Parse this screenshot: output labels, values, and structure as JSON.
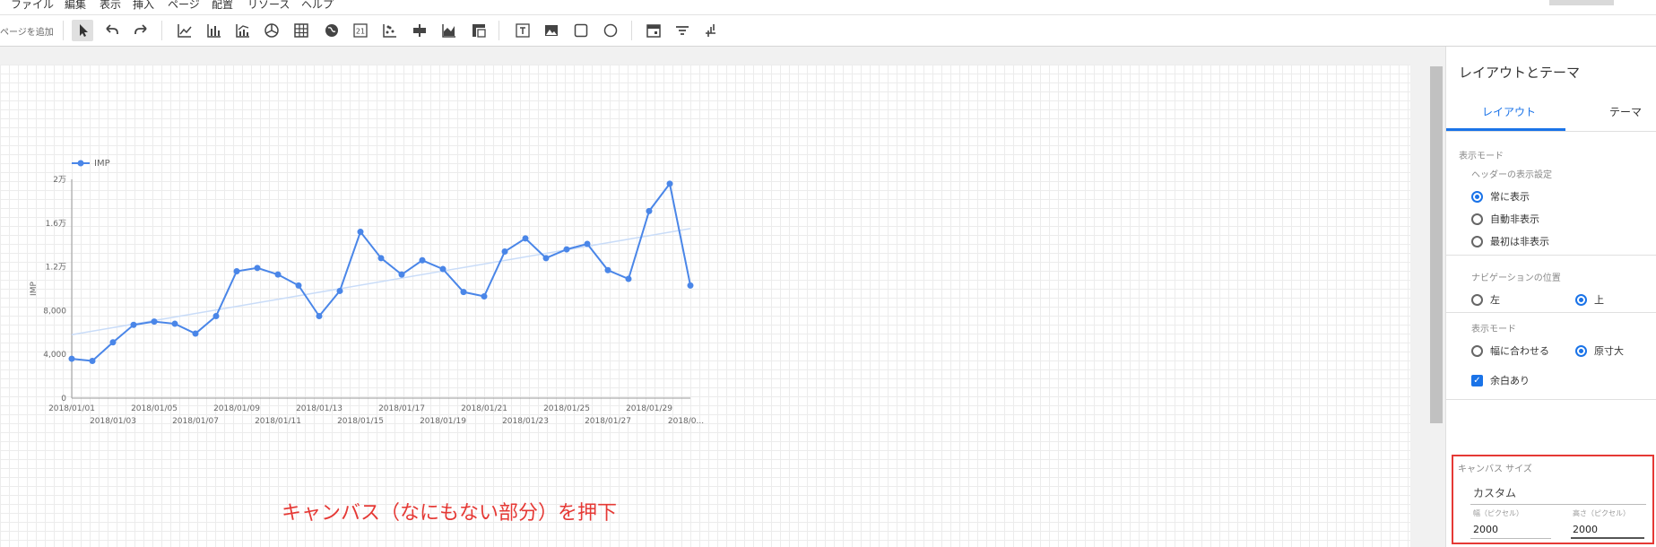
{
  "menu": {
    "items": [
      "ファイル",
      "編集",
      "表示",
      "挿入",
      "ページ",
      "配置",
      "リソース",
      "ヘルプ"
    ]
  },
  "toolbar": {
    "add_page": "ページを追加",
    "tools": [
      "select-cursor-icon",
      "undo-icon",
      "redo-icon",
      "line-chart-icon",
      "bar-chart-icon",
      "combo-chart-icon",
      "pie-chart-icon",
      "table-icon",
      "geo-map-icon",
      "scorecard-icon",
      "scatter-chart-icon",
      "bullet-chart-icon",
      "area-chart-icon",
      "pivot-table-icon",
      "text-box-icon",
      "image-icon",
      "rectangle-icon",
      "circle-icon",
      "date-range-icon",
      "filter-icon",
      "data-control-icon"
    ],
    "scorecard_text": "21"
  },
  "chart_data": {
    "type": "line",
    "legend": "IMP",
    "legend_position": "top-left",
    "ylabel": "IMP",
    "yticks": [
      "0",
      "4,000",
      "8,000",
      "1.2万",
      "1.6万",
      "2万"
    ],
    "ylim": [
      0,
      20000
    ],
    "x_tick_labels_upper": [
      "2018/01/01",
      "2018/01/05",
      "2018/01/09",
      "2018/01/13",
      "2018/01/17",
      "2018/01/21",
      "2018/01/25",
      "2018/01/29"
    ],
    "x_tick_labels_lower": [
      "2018/01/03",
      "2018/01/07",
      "2018/01/11",
      "2018/01/15",
      "2018/01/19",
      "2018/01/23",
      "2018/01/27",
      "2018/0..."
    ],
    "x": [
      "2018/01/01",
      "2018/01/02",
      "2018/01/03",
      "2018/01/04",
      "2018/01/05",
      "2018/01/06",
      "2018/01/07",
      "2018/01/08",
      "2018/01/09",
      "2018/01/10",
      "2018/01/11",
      "2018/01/12",
      "2018/01/13",
      "2018/01/14",
      "2018/01/15",
      "2018/01/16",
      "2018/01/17",
      "2018/01/18",
      "2018/01/19",
      "2018/01/20",
      "2018/01/21",
      "2018/01/22",
      "2018/01/23",
      "2018/01/24",
      "2018/01/25",
      "2018/01/26",
      "2018/01/27",
      "2018/01/28",
      "2018/01/29",
      "2018/01/30",
      "2018/01/31"
    ],
    "values": [
      3600,
      3400,
      5100,
      6700,
      7000,
      6800,
      5900,
      7500,
      11600,
      11900,
      11300,
      10300,
      7500,
      9800,
      15200,
      12800,
      11300,
      12600,
      11800,
      9700,
      9300,
      13400,
      14600,
      12800,
      13600,
      14100,
      11700,
      10900,
      17100,
      19600,
      10300
    ],
    "trendline": {
      "start": 5800,
      "end": 15500
    },
    "colors": {
      "series": "#4a86e8",
      "trend": "#c9dcf8",
      "axis": "#999999"
    },
    "grid": false
  },
  "annotation": "キャンバス（なにもない部分）を押下",
  "panel": {
    "title": "レイアウトとテーマ",
    "tabs": [
      "レイアウト",
      "テーマ"
    ],
    "display_mode_label": "表示モード",
    "header_label": "ヘッダーの表示設定",
    "header_options": [
      "常に表示",
      "自動非表示",
      "最初は非表示"
    ],
    "nav_label": "ナビゲーションの位置",
    "nav_options": [
      "左",
      "上"
    ],
    "view_mode_label": "表示モード",
    "view_options": [
      "幅に合わせる",
      "原寸大"
    ],
    "margin_label": "余白あり",
    "canvas_size_label": "キャンバス サイズ",
    "canvas_size_value": "カスタム",
    "width_label": "幅（ピクセル）",
    "height_label": "高さ（ピクセル）",
    "width_value": "2000",
    "height_value": "2000"
  },
  "accent": "#1a73e8",
  "annotation_color": "#e53935"
}
